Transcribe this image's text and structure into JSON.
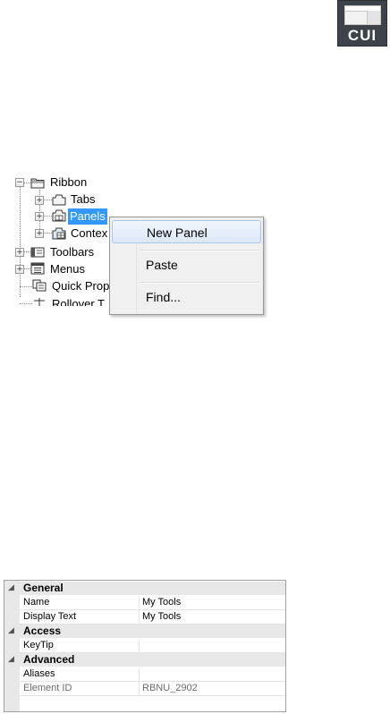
{
  "badge": {
    "label": "CUI"
  },
  "tree": {
    "items": [
      {
        "label": "Ribbon",
        "icon": "ribbon-folder-icon"
      },
      {
        "label": "Tabs",
        "icon": "tabs-icon"
      },
      {
        "label": "Panels",
        "icon": "panels-icon",
        "selected": true
      },
      {
        "label": "Contex",
        "icon": "contextual-tab-icon"
      },
      {
        "label": "Toolbars",
        "icon": "toolbars-icon"
      },
      {
        "label": "Menus",
        "icon": "menus-icon"
      },
      {
        "label": "Quick Prop",
        "icon": "quick-properties-icon"
      },
      {
        "label": "Rollover T",
        "icon": "rollover-tooltips-icon"
      }
    ]
  },
  "context_menu": {
    "items": [
      "New Panel",
      "Paste",
      "Find..."
    ]
  },
  "properties": {
    "general": {
      "title": "General",
      "rows": [
        {
          "key": "Name",
          "value": "My Tools"
        },
        {
          "key": "Display Text",
          "value": "My Tools"
        }
      ]
    },
    "access": {
      "title": "Access",
      "rows": [
        {
          "key": "KeyTip",
          "value": ""
        }
      ]
    },
    "advanced": {
      "title": "Advanced",
      "rows": [
        {
          "key": "Aliases",
          "value": ""
        },
        {
          "key": "Element ID",
          "value": "RBNU_2902"
        }
      ]
    }
  },
  "colors": {
    "selection": "#3399ff",
    "badge_bg": "#3d4349"
  }
}
